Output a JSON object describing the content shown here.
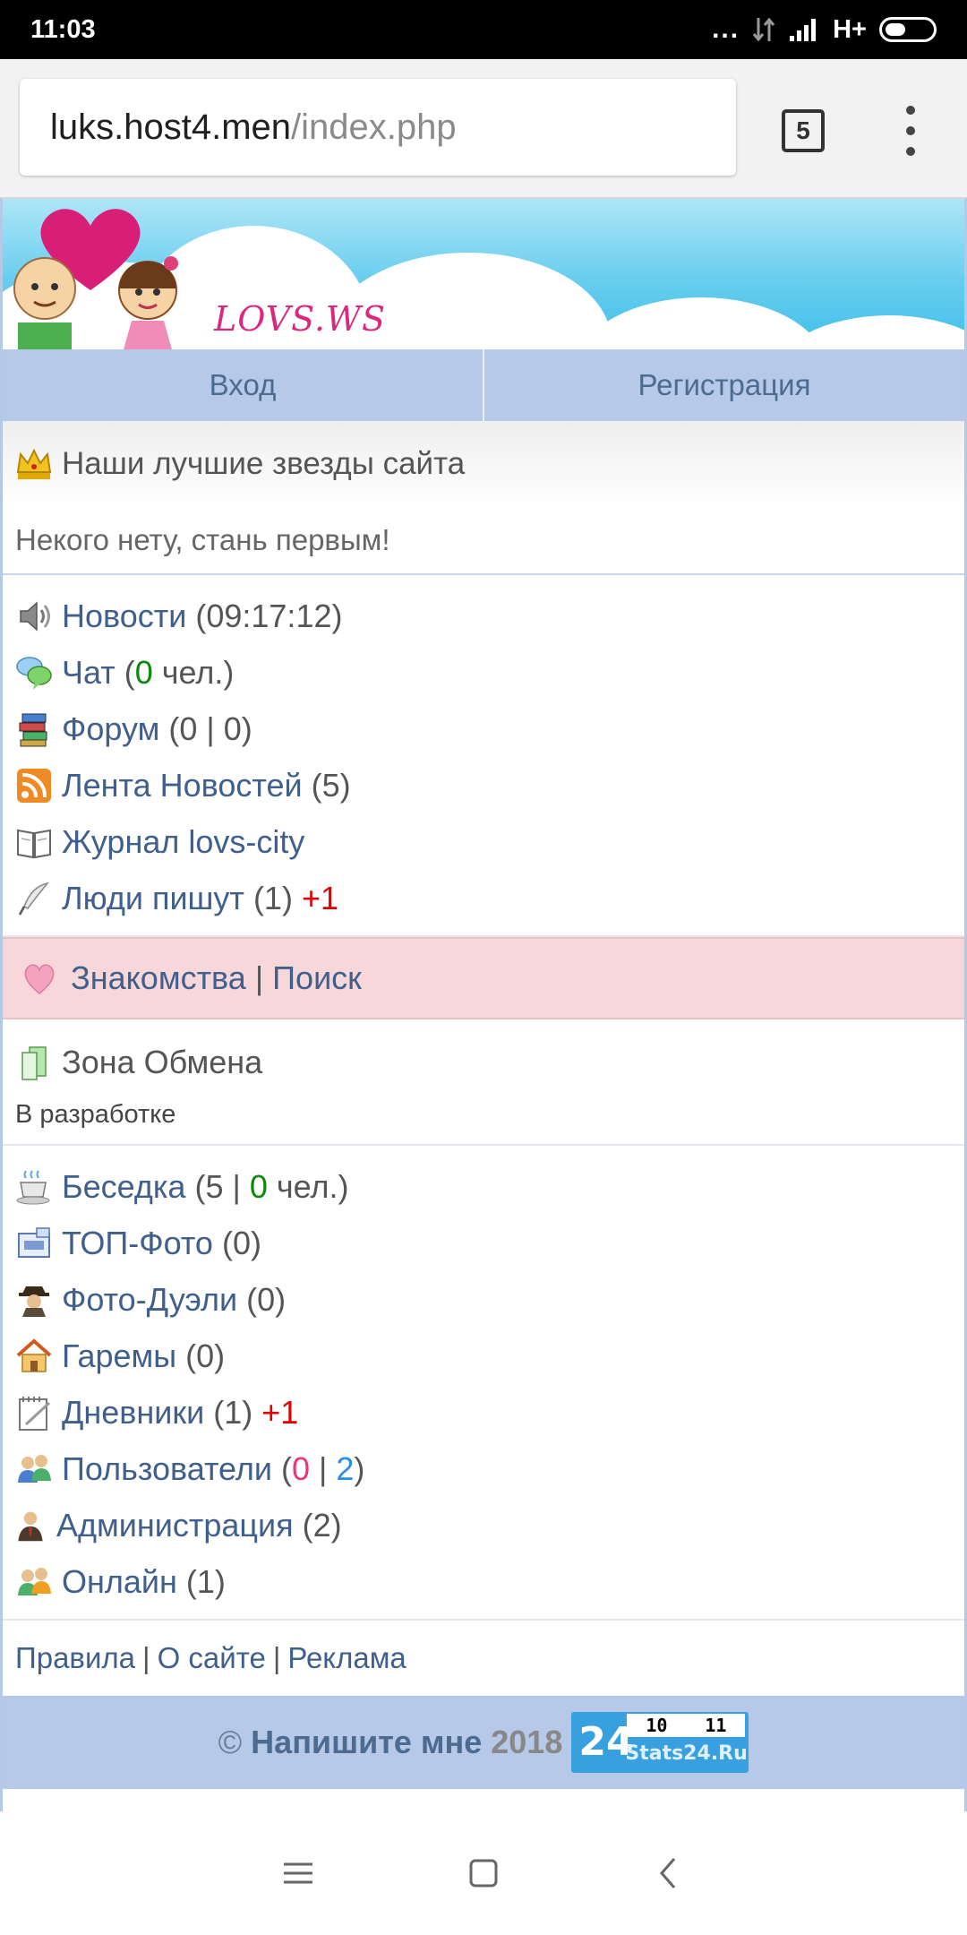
{
  "status_bar": {
    "time": "11:03",
    "dots": "...",
    "network": "H+"
  },
  "browser": {
    "url_host": "luks.host4.men",
    "url_path": "/index.php",
    "tab_count": "5"
  },
  "banner": {
    "logo_text": "LOVS.WS"
  },
  "auth": {
    "login": "Вход",
    "register": "Регистрация"
  },
  "stars": {
    "title": "Наши лучшие звезды сайта",
    "note": "Некого нету, стань первым!"
  },
  "menu1": {
    "news": {
      "label": "Новости",
      "time": "(09:17:12)"
    },
    "chat": {
      "label": "Чат",
      "open": "(",
      "count": "0",
      "suffix": "чел.)"
    },
    "forum": {
      "label": "Форум",
      "counts": "(0 | 0)"
    },
    "feed": {
      "label": "Лента Новостей",
      "counts": "(5)"
    },
    "journal": {
      "label": "Журнал lovs-city"
    },
    "people": {
      "label": "Люди пишут",
      "counts": "(1)",
      "plus": "+1"
    }
  },
  "dating": {
    "label": "Знакомства",
    "sep": "|",
    "search": "Поиск"
  },
  "exchange": {
    "label": "Зона Обмена",
    "status": "В разработке"
  },
  "menu2": {
    "gazebo": {
      "label": "Беседка",
      "open": "(5 |",
      "count": "0",
      "suffix": "чел.)"
    },
    "top_photo": {
      "label": "ТОП-Фото",
      "counts": "(0)"
    },
    "photo_duels": {
      "label": "Фото-Дуэли",
      "counts": "(0)"
    },
    "harems": {
      "label": "Гаремы",
      "counts": "(0)"
    },
    "diaries": {
      "label": "Дневники",
      "counts": "(1)",
      "plus": "+1"
    },
    "users": {
      "label": "Пользователи",
      "open": "(",
      "a": "0",
      "sep": "|",
      "b": "2",
      "close": ")"
    },
    "admin": {
      "label": "Администрация",
      "counts": "(2)"
    },
    "online": {
      "label": "Онлайн",
      "counts": "(1)"
    }
  },
  "footer": {
    "rules": "Правила",
    "about": "О сайте",
    "ads": "Реклама",
    "sep": "|",
    "copy_symbol": "©",
    "write_me": "Напишите мне",
    "year": "2018"
  },
  "counter": {
    "left_num": "10",
    "right_num": "11",
    "badge": "24",
    "brand": "Stats24.Ru"
  },
  "icons": {
    "colors": {
      "accent": "#3f5f8c",
      "green": "#0a8a0a",
      "red": "#e00000",
      "pink": "#e8357b",
      "blue": "#2a8ee6",
      "auth_bg": "#b6c9e8",
      "dating_bg": "#f7d7da"
    }
  }
}
